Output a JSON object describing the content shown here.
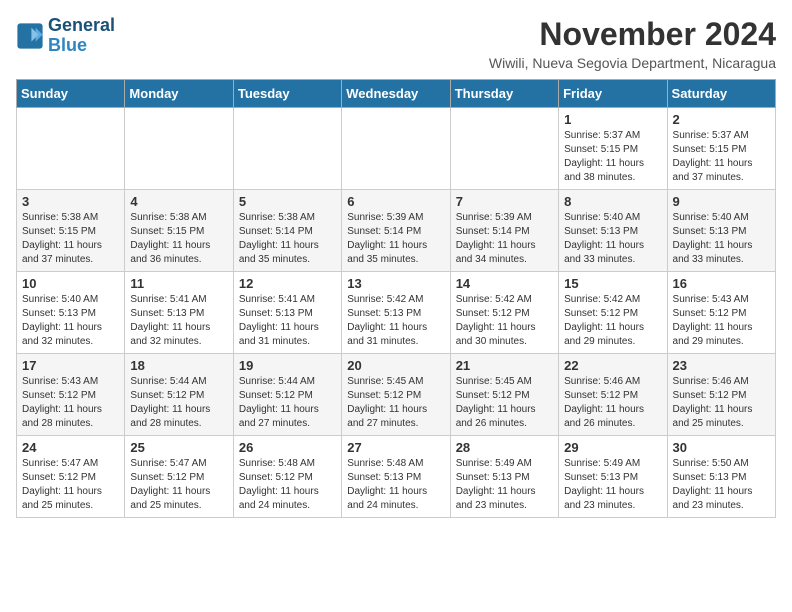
{
  "logo": {
    "text_general": "General",
    "text_blue": "Blue"
  },
  "header": {
    "month": "November 2024",
    "location": "Wiwili, Nueva Segovia Department, Nicaragua"
  },
  "weekdays": [
    "Sunday",
    "Monday",
    "Tuesday",
    "Wednesday",
    "Thursday",
    "Friday",
    "Saturday"
  ],
  "weeks": [
    [
      {
        "day": "",
        "info": ""
      },
      {
        "day": "",
        "info": ""
      },
      {
        "day": "",
        "info": ""
      },
      {
        "day": "",
        "info": ""
      },
      {
        "day": "",
        "info": ""
      },
      {
        "day": "1",
        "info": "Sunrise: 5:37 AM\nSunset: 5:15 PM\nDaylight: 11 hours\nand 38 minutes."
      },
      {
        "day": "2",
        "info": "Sunrise: 5:37 AM\nSunset: 5:15 PM\nDaylight: 11 hours\nand 37 minutes."
      }
    ],
    [
      {
        "day": "3",
        "info": "Sunrise: 5:38 AM\nSunset: 5:15 PM\nDaylight: 11 hours\nand 37 minutes."
      },
      {
        "day": "4",
        "info": "Sunrise: 5:38 AM\nSunset: 5:15 PM\nDaylight: 11 hours\nand 36 minutes."
      },
      {
        "day": "5",
        "info": "Sunrise: 5:38 AM\nSunset: 5:14 PM\nDaylight: 11 hours\nand 35 minutes."
      },
      {
        "day": "6",
        "info": "Sunrise: 5:39 AM\nSunset: 5:14 PM\nDaylight: 11 hours\nand 35 minutes."
      },
      {
        "day": "7",
        "info": "Sunrise: 5:39 AM\nSunset: 5:14 PM\nDaylight: 11 hours\nand 34 minutes."
      },
      {
        "day": "8",
        "info": "Sunrise: 5:40 AM\nSunset: 5:13 PM\nDaylight: 11 hours\nand 33 minutes."
      },
      {
        "day": "9",
        "info": "Sunrise: 5:40 AM\nSunset: 5:13 PM\nDaylight: 11 hours\nand 33 minutes."
      }
    ],
    [
      {
        "day": "10",
        "info": "Sunrise: 5:40 AM\nSunset: 5:13 PM\nDaylight: 11 hours\nand 32 minutes."
      },
      {
        "day": "11",
        "info": "Sunrise: 5:41 AM\nSunset: 5:13 PM\nDaylight: 11 hours\nand 32 minutes."
      },
      {
        "day": "12",
        "info": "Sunrise: 5:41 AM\nSunset: 5:13 PM\nDaylight: 11 hours\nand 31 minutes."
      },
      {
        "day": "13",
        "info": "Sunrise: 5:42 AM\nSunset: 5:13 PM\nDaylight: 11 hours\nand 31 minutes."
      },
      {
        "day": "14",
        "info": "Sunrise: 5:42 AM\nSunset: 5:12 PM\nDaylight: 11 hours\nand 30 minutes."
      },
      {
        "day": "15",
        "info": "Sunrise: 5:42 AM\nSunset: 5:12 PM\nDaylight: 11 hours\nand 29 minutes."
      },
      {
        "day": "16",
        "info": "Sunrise: 5:43 AM\nSunset: 5:12 PM\nDaylight: 11 hours\nand 29 minutes."
      }
    ],
    [
      {
        "day": "17",
        "info": "Sunrise: 5:43 AM\nSunset: 5:12 PM\nDaylight: 11 hours\nand 28 minutes."
      },
      {
        "day": "18",
        "info": "Sunrise: 5:44 AM\nSunset: 5:12 PM\nDaylight: 11 hours\nand 28 minutes."
      },
      {
        "day": "19",
        "info": "Sunrise: 5:44 AM\nSunset: 5:12 PM\nDaylight: 11 hours\nand 27 minutes."
      },
      {
        "day": "20",
        "info": "Sunrise: 5:45 AM\nSunset: 5:12 PM\nDaylight: 11 hours\nand 27 minutes."
      },
      {
        "day": "21",
        "info": "Sunrise: 5:45 AM\nSunset: 5:12 PM\nDaylight: 11 hours\nand 26 minutes."
      },
      {
        "day": "22",
        "info": "Sunrise: 5:46 AM\nSunset: 5:12 PM\nDaylight: 11 hours\nand 26 minutes."
      },
      {
        "day": "23",
        "info": "Sunrise: 5:46 AM\nSunset: 5:12 PM\nDaylight: 11 hours\nand 25 minutes."
      }
    ],
    [
      {
        "day": "24",
        "info": "Sunrise: 5:47 AM\nSunset: 5:12 PM\nDaylight: 11 hours\nand 25 minutes."
      },
      {
        "day": "25",
        "info": "Sunrise: 5:47 AM\nSunset: 5:12 PM\nDaylight: 11 hours\nand 25 minutes."
      },
      {
        "day": "26",
        "info": "Sunrise: 5:48 AM\nSunset: 5:12 PM\nDaylight: 11 hours\nand 24 minutes."
      },
      {
        "day": "27",
        "info": "Sunrise: 5:48 AM\nSunset: 5:13 PM\nDaylight: 11 hours\nand 24 minutes."
      },
      {
        "day": "28",
        "info": "Sunrise: 5:49 AM\nSunset: 5:13 PM\nDaylight: 11 hours\nand 23 minutes."
      },
      {
        "day": "29",
        "info": "Sunrise: 5:49 AM\nSunset: 5:13 PM\nDaylight: 11 hours\nand 23 minutes."
      },
      {
        "day": "30",
        "info": "Sunrise: 5:50 AM\nSunset: 5:13 PM\nDaylight: 11 hours\nand 23 minutes."
      }
    ]
  ]
}
